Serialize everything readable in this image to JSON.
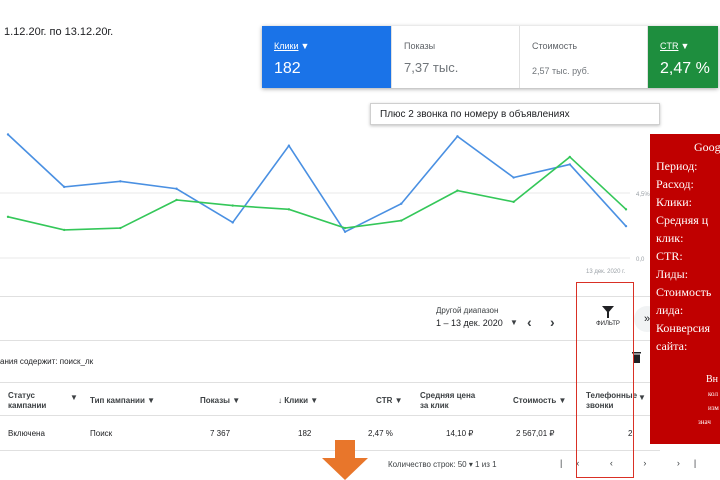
{
  "period_text": "1.12.20г. по 13.12.20г.",
  "metrics": [
    {
      "label": "Клики",
      "value": "182"
    },
    {
      "label": "Показы",
      "value": "7,37 тыс."
    },
    {
      "label": "Стоимость",
      "value": "2,57 тыс. руб."
    },
    {
      "label": "CTR",
      "value": "2,47 %"
    }
  ],
  "tooltip": "Плюс 2 звонка по номеру в объявлениях",
  "chart_data": {
    "type": "line",
    "y_ticks": [
      "4,5%",
      "0,0"
    ],
    "x_end_label": "13 дек. 2020 г.",
    "series": [
      {
        "values": [
          6.6,
          3.8,
          4.1,
          3.7,
          1.9,
          6.0,
          1.4,
          2.9,
          6.5,
          4.3,
          5.0,
          1.7
        ],
        "color": "#4a90e2"
      },
      {
        "values": [
          2.2,
          1.5,
          1.6,
          3.1,
          2.8,
          2.6,
          1.6,
          2.0,
          3.6,
          3.0,
          5.4,
          2.6
        ],
        "color": "#34c759"
      }
    ]
  },
  "date_range": {
    "title": "Другой диапазон",
    "value": "1 – 13 дек. 2020"
  },
  "filter_label": "ФИЛЬТР",
  "filter_text": "ания содержит: поиск_лк",
  "table": {
    "headers": {
      "status": "Статус кампании",
      "type": "Тип кампании",
      "impressions": "Показы",
      "clicks": "Клики",
      "ctr": "CTR",
      "avg_cpc": "Средняя цена за клик",
      "cost": "Стоимость",
      "calls": "Телефонные звонки"
    },
    "row": {
      "status": "Включена",
      "type": "Поиск",
      "impressions": "7 367",
      "clicks": "182",
      "ctr": "2,47 %",
      "avg_cpc": "14,10 ₽",
      "cost": "2 567,01 ₽",
      "calls": "2"
    }
  },
  "footer": {
    "rows_text": "Количество строк:  50  ▾    1 из 1"
  },
  "info_panel": {
    "title": "Googl",
    "lines": [
      "Период:",
      "Расход:",
      "Клики:",
      "Средняя ц",
      "клик:",
      "CTR:",
      "Лиды:",
      "Стоимость",
      "лида:",
      "Конверсия",
      "сайта:"
    ],
    "notes": [
      "Вн",
      "кол",
      "изм",
      "знач"
    ]
  }
}
